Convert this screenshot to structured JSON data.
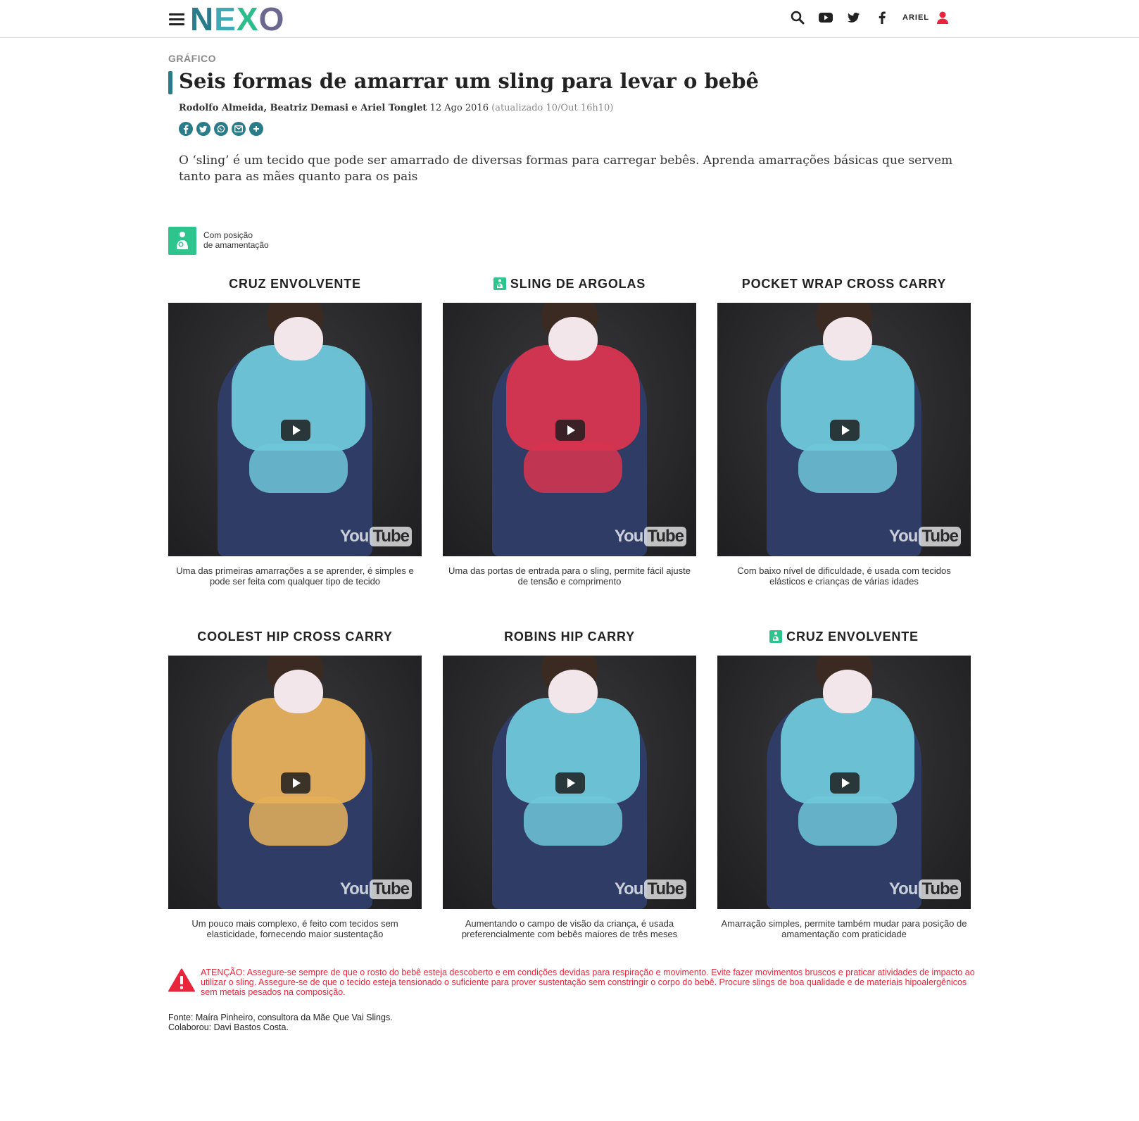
{
  "header": {
    "logo_letters": [
      "N",
      "E",
      "X",
      "O"
    ],
    "user_label": "ARIEL",
    "icons": [
      "menu-icon",
      "search-icon",
      "youtube-icon",
      "twitter-icon",
      "facebook-icon",
      "user-icon"
    ]
  },
  "article": {
    "kicker": "GRÁFICO",
    "title": "Seis formas de amarrar um sling para levar o bebê",
    "authors": "Rodolfo Almeida, Beatriz Demasi e Ariel Tonglet",
    "date": "12 Ago 2016",
    "updated": "(atualizado 10/Out 16h10)",
    "share_icons": [
      "facebook-icon",
      "twitter-icon",
      "whatsapp-icon",
      "email-icon",
      "plus-icon"
    ],
    "lead": "O ‘sling’ é um tecido que pode ser amarrado de diversas formas para carregar bebês. Aprenda amarrações básicas que servem tanto para as mães quanto para os pais"
  },
  "legend": {
    "line1": "Com posição",
    "line2": "de amamentação"
  },
  "cards": [
    {
      "title": "CRUZ ENVOLVENTE",
      "breastfeeding": false,
      "desc": "Uma das primeiras amarrações a se aprender, é simples e pode ser feita com qualquer tipo de tecido",
      "wrap_color": "#6fc7d9"
    },
    {
      "title": "SLING DE ARGOLAS",
      "breastfeeding": true,
      "desc": "Uma das portas de entrada para o sling, permite fácil ajuste de tensão e comprimento",
      "wrap_color": "#d8344f"
    },
    {
      "title": "POCKET WRAP CROSS CARRY",
      "breastfeeding": false,
      "desc": "Com baixo nível de dificuldade, é usada com tecidos elásticos e crianças de várias idades",
      "wrap_color": "#6fc7d9"
    },
    {
      "title": "COOLEST HIP CROSS CARRY",
      "breastfeeding": false,
      "desc": "Um pouco mais complexo, é feito com tecidos sem elasticidade, fornecendo maior sustentação",
      "wrap_color": "#e6b05a"
    },
    {
      "title": "ROBINS HIP CARRY",
      "breastfeeding": false,
      "desc": "Aumentando o campo de visão da criança, é usada preferencialmente com bebês maiores de três meses",
      "wrap_color": "#6fc7d9"
    },
    {
      "title": "CRUZ ENVOLVENTE",
      "breastfeeding": true,
      "desc": "Amarração simples, permite também mudar para posição de amamentação com praticidade",
      "wrap_color": "#6fc7d9"
    }
  ],
  "video": {
    "brand_you": "You",
    "brand_tube": "Tube"
  },
  "warning": "ATENÇÃO: Assegure-se sempre de que o rosto do bebê esteja descoberto e em condições devidas para respiração e movimento. Evite fazer  movimentos bruscos e praticar atividades de impacto ao utilizar o sling. Assegure-se de que o tecido esteja tensionado o suficiente para prover sustentação sem constringir o corpo do bebê. Procure slings de boa qualidade e de materiais hipoalergênicos sem metais pesados na composição.",
  "source": {
    "line1": "Fonte: Maíra Pinheiro, consultora da Mãe Que Vai Slings.",
    "line2": "Colaborou: Davi Bastos Costa."
  },
  "colors": {
    "teal": "#2a7c8a",
    "green_badge": "#2dc48d",
    "warning_red": "#e8253b"
  }
}
